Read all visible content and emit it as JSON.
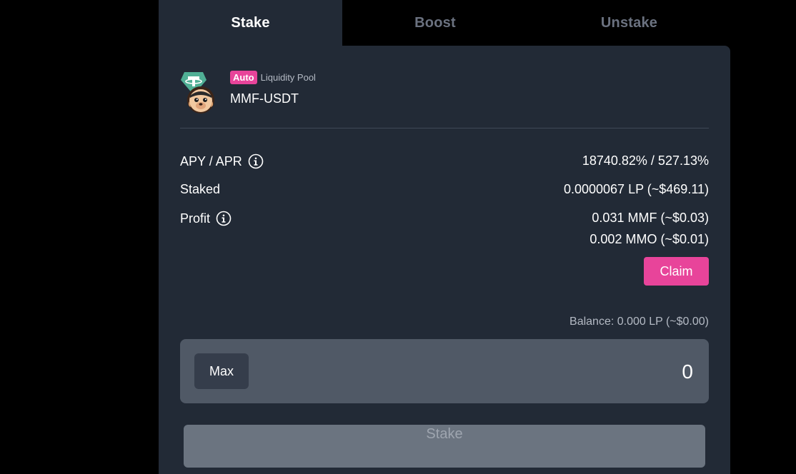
{
  "tabs": [
    {
      "label": "Stake",
      "active": true
    },
    {
      "label": "Boost",
      "active": false
    },
    {
      "label": "Unstake",
      "active": false
    }
  ],
  "pool": {
    "badge": "Auto",
    "type": "Liquidity Pool",
    "name": "MMF-USDT",
    "icons": [
      "usdt-icon",
      "mmf-icon"
    ]
  },
  "stats": {
    "apy_label": "APY / APR",
    "apy_value": "18740.82% / 527.13%",
    "staked_label": "Staked",
    "staked_value": "0.0000067 LP (~$469.11)",
    "profit_label": "Profit",
    "profit_value_1": "0.031 MMF (~$0.03)",
    "profit_value_2": "0.002 MMO (~$0.01)"
  },
  "claim_label": "Claim",
  "balance_text": "Balance: 0.000 LP (~$0.00)",
  "amount": {
    "max_label": "Max",
    "value": "0"
  },
  "stake_button_label": "Stake",
  "colors": {
    "background": "#000000",
    "panel": "#222a36",
    "accent": "#e8449a",
    "input_bg": "#505966",
    "tether_green": "#50af95"
  }
}
